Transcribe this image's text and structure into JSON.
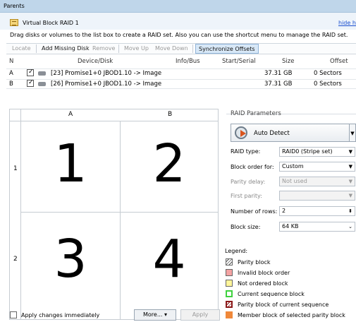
{
  "titlebar": {
    "title": "Parents"
  },
  "header": {
    "title": "Virtual Block RAID 1",
    "hide_link": "hide hi",
    "hint": "Drag disks or volumes to the list box to create a RAID set. Also you can use the shortcut menu to manage the RAID set."
  },
  "toolbar": {
    "locate": "Locate",
    "add_missing": "Add Missing Disk",
    "remove": "Remove",
    "move_up": "Move Up",
    "move_down": "Move Down",
    "sync": "Synchronize Offsets"
  },
  "table": {
    "columns": [
      "N",
      "Device/Disk",
      "Info/Bus",
      "Start/Serial",
      "Size",
      "Offset"
    ],
    "rows": [
      {
        "n": "A",
        "device": "[23] Promise1+0 JBOD1.10 -> Image",
        "info": "",
        "start": "",
        "size": "37.31 GB",
        "offset": "0 Sectors"
      },
      {
        "n": "B",
        "device": "[26] Promise1+0 JBOD1.10 -> Image",
        "info": "",
        "start": "",
        "size": "37.31 GB",
        "offset": "0 Sectors"
      }
    ]
  },
  "grid": {
    "cols": [
      "A",
      "B"
    ],
    "rows": [
      "1",
      "2"
    ],
    "cells": [
      "1",
      "2",
      "3",
      "4"
    ]
  },
  "params": {
    "title": "RAID Parameters",
    "auto_detect": "Auto Detect",
    "raid_type_label": "RAID type:",
    "raid_type_value": "RAID0 (Stripe set)",
    "block_order_label": "Block order for:",
    "block_order_value": "Custom",
    "parity_delay_label": "Parity delay:",
    "parity_delay_value": "Not used",
    "first_parity_label": "First parity:",
    "first_parity_value": "",
    "rows_label": "Number of rows:",
    "rows_value": "2",
    "block_size_label": "Block size:",
    "block_size_value": "64 KB"
  },
  "legend": {
    "title": "Legend:",
    "items": [
      {
        "label": "Parity block",
        "color": "#ffffff"
      },
      {
        "label": "Invalid block order",
        "color": "#f4a3a3"
      },
      {
        "label": "Not ordered block",
        "color": "#fff59a"
      },
      {
        "label": "Current sequence block",
        "color": "#3fd13f"
      },
      {
        "label": "Parity block of current sequence",
        "color": "#8b1a1a"
      },
      {
        "label": "Member block of selected parity block",
        "color": "#f0883a"
      }
    ]
  },
  "footer": {
    "apply_immediately": "Apply changes immediately",
    "more": "More...",
    "more_arrow": "▾",
    "apply": "Apply"
  }
}
